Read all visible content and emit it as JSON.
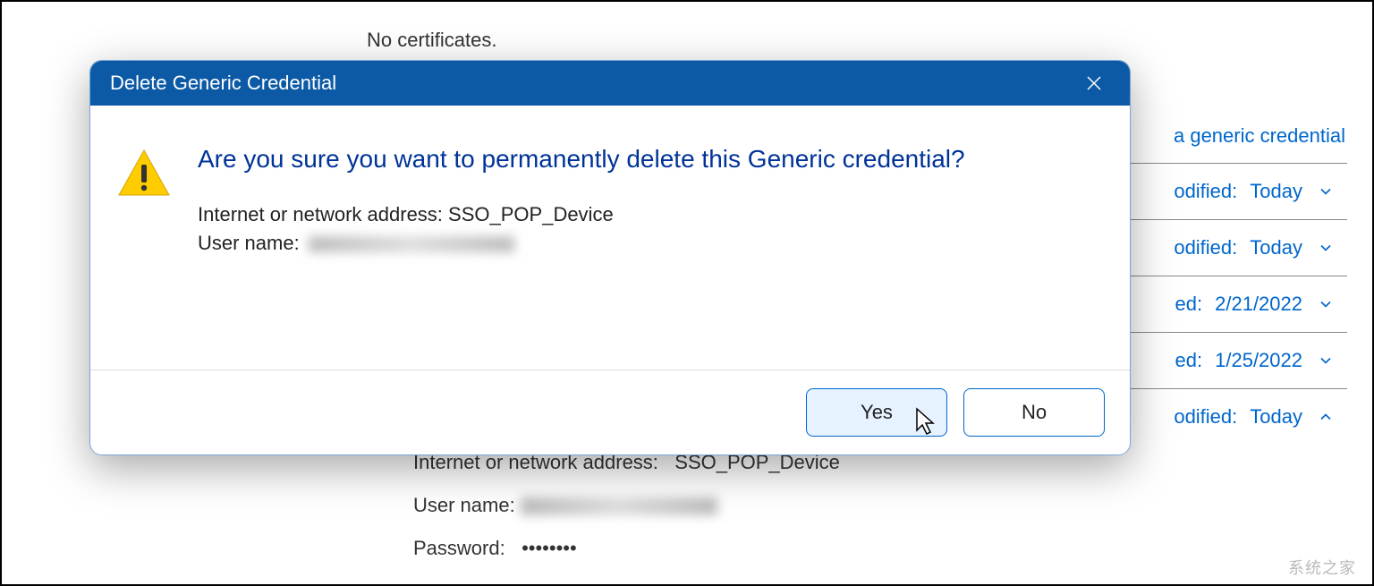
{
  "background": {
    "no_certificates_text": "No certificates.",
    "add_generic_credential_link": "a generic credential",
    "rows": [
      {
        "label": "odified:",
        "value": "Today",
        "expanded": false
      },
      {
        "label": "odified:",
        "value": "Today",
        "expanded": false
      },
      {
        "label": "ed:",
        "value": "2/21/2022",
        "expanded": false
      },
      {
        "label": "ed:",
        "value": "1/25/2022",
        "expanded": false
      },
      {
        "label": "odified:",
        "value": "Today",
        "expanded": true
      }
    ],
    "details": {
      "address_label": "Internet or network address:",
      "address_value": "SSO_POP_Device",
      "user_label": "User name:",
      "password_label": "Password:",
      "password_masked": "••••••••"
    }
  },
  "dialog": {
    "title": "Delete Generic Credential",
    "main_instruction": "Are you sure you want to permanently delete this Generic credential?",
    "address_label": "Internet or network address:",
    "address_value": "SSO_POP_Device",
    "user_label": "User name:",
    "buttons": {
      "yes": "Yes",
      "no": "No"
    }
  },
  "watermark": "系统之家"
}
